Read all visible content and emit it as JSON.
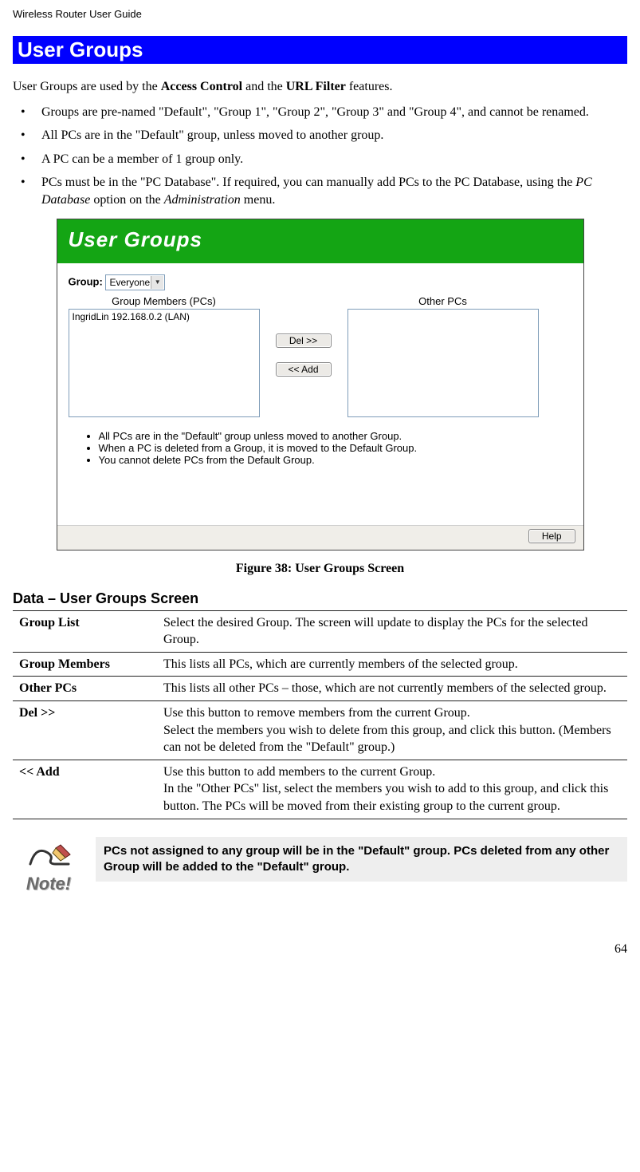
{
  "header": "Wireless Router User Guide",
  "banner_title": "User Groups",
  "intro_pre": "User Groups are used by the ",
  "intro_b1": "Access Control",
  "intro_mid": " and the ",
  "intro_b2": "URL Filter",
  "intro_post": " features.",
  "bullets": [
    "Groups are pre-named \"Default\", \"Group 1\", \"Group 2\", \"Group 3\" and \"Group 4\", and cannot be renamed.",
    "All PCs are in the \"Default\" group, unless moved to another group.",
    "A PC can be a member of 1 group only."
  ],
  "bullet4_pre": "PCs must be in the \"PC Database\". If required, you can manually add PCs to the PC Database, using the ",
  "bullet4_i1": "PC Database",
  "bullet4_mid": " option on the ",
  "bullet4_i2": "Administration",
  "bullet4_post": " menu.",
  "screenshot": {
    "title": "User Groups",
    "group_label": "Group",
    "group_value": "Everyone",
    "members_header": "Group Members (PCs)",
    "other_header": "Other PCs",
    "member_item": "IngridLin 192.168.0.2 (LAN)",
    "del_btn": "Del >>",
    "add_btn": "<< Add",
    "notes": [
      "All PCs are in the \"Default\" group unless moved to another Group.",
      "When a PC is deleted from a Group, it is moved to the Default Group.",
      "You cannot delete PCs from the Default Group."
    ],
    "help_btn": "Help"
  },
  "caption": "Figure 38: User Groups Screen",
  "subheading": "Data – User Groups Screen",
  "table": {
    "row1_h": "Group List",
    "row1_d": "Select the desired Group. The screen will update to display the PCs for the selected Group.",
    "row2_h": "Group Members",
    "row2_d": "This lists all PCs, which are currently members of the selected group.",
    "row3_h": "Other PCs",
    "row3_d": "This lists all other PCs – those, which are not currently members of the selected group.",
    "row4_h": "Del >>",
    "row4_d1": "Use this button to remove members from the current Group.",
    "row4_d2": "Select the members you wish to delete from this group, and click this button. (Members can not be deleted from the \"Default\" group.)",
    "row5_h": "<< Add",
    "row5_d1": "Use this button to add members to the current Group.",
    "row5_d2": "In the \"Other PCs\" list, select the members you wish to add to this group, and click this button. The PCs will be moved from their existing group to the current group."
  },
  "note_label": "Note!",
  "note_text": "PCs not assigned to any group will be in the \"Default\" group. PCs deleted from any other Group will be added to the \"Default\" group.",
  "page_number": "64"
}
